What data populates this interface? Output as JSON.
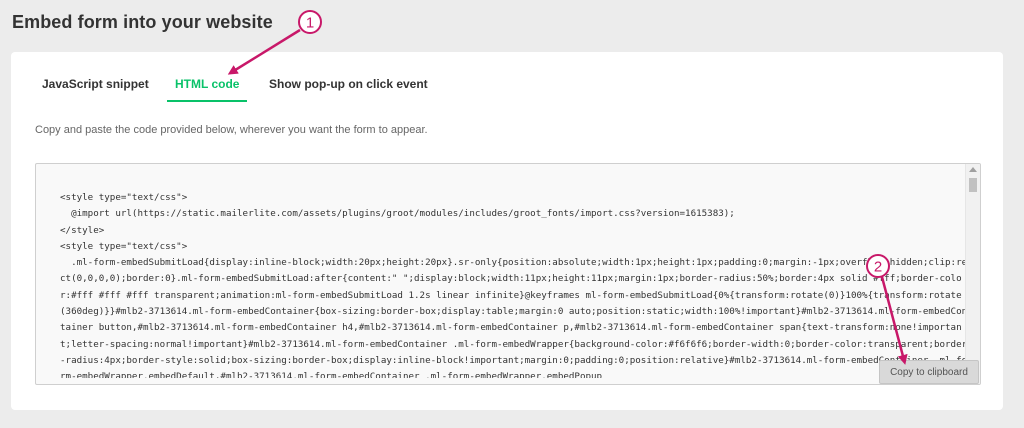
{
  "page": {
    "title": "Embed form into your website"
  },
  "tabs": [
    {
      "label": "JavaScript snippet",
      "active": false
    },
    {
      "label": "HTML code",
      "active": true
    },
    {
      "label": "Show pop-up on click event",
      "active": false
    }
  ],
  "instructions": "Copy and paste the code provided below, wherever you want the form to appear.",
  "code": "<style type=\"text/css\">\n  @import url(https://static.mailerlite.com/assets/plugins/groot/modules/includes/groot_fonts/import.css?version=1615383);\n</style>\n<style type=\"text/css\">\n  .ml-form-embedSubmitLoad{display:inline-block;width:20px;height:20px}.sr-only{position:absolute;width:1px;height:1px;padding:0;margin:-1px;overflow:hidden;clip:rect(0,0,0,0);border:0}.ml-form-embedSubmitLoad:after{content:\" \";display:block;width:11px;height:11px;margin:1px;border-radius:50%;border:4px solid #fff;border-color:#fff #fff #fff transparent;animation:ml-form-embedSubmitLoad 1.2s linear infinite}@keyframes ml-form-embedSubmitLoad{0%{transform:rotate(0)}100%{transform:rotate(360deg)}}#mlb2-3713614.ml-form-embedContainer{box-sizing:border-box;display:table;margin:0 auto;position:static;width:100%!important}#mlb2-3713614.ml-form-embedContainer button,#mlb2-3713614.ml-form-embedContainer h4,#mlb2-3713614.ml-form-embedContainer p,#mlb2-3713614.ml-form-embedContainer span{text-transform:none!important;letter-spacing:normal!important}#mlb2-3713614.ml-form-embedContainer .ml-form-embedWrapper{background-color:#f6f6f6;border-width:0;border-color:transparent;border-radius:4px;border-style:solid;box-sizing:border-box;display:inline-block!important;margin:0;padding:0;position:relative}#mlb2-3713614.ml-form-embedContainer .ml-form-embedWrapper.embedDefault,#mlb2-3713614.ml-form-embedContainer .ml-form-embedWrapper.embedPopup",
  "copy_button": "Copy to clipboard",
  "callouts": [
    {
      "number": "1"
    },
    {
      "number": "2"
    }
  ],
  "colors": {
    "accent": "#09c269",
    "annotation": "#c81869"
  }
}
